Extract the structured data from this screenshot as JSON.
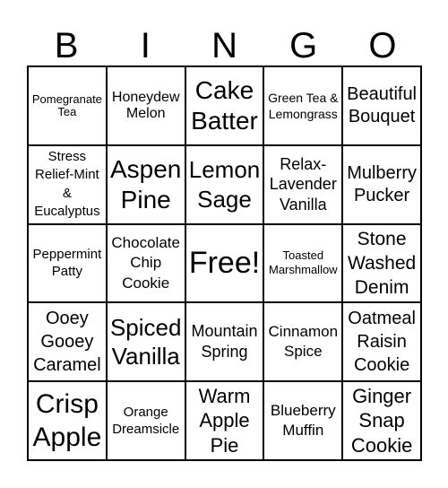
{
  "header": [
    "B",
    "I",
    "N",
    "G",
    "O"
  ],
  "cells": [
    [
      "Pomegranate Tea",
      "Honeydew Melon",
      "Cake Batter",
      "Green Tea & Lemongrass",
      "Beautiful Bouquet"
    ],
    [
      "Stress Relief-Mint & Eucalyptus",
      "Aspen Pine",
      "Lemon Sage",
      "Relax-Lavender Vanilla",
      "Mulberry Pucker"
    ],
    [
      "Peppermint Patty",
      "Chocolate Chip Cookie",
      "Free!",
      "Toasted Marshmallow",
      "Stone Washed Denim"
    ],
    [
      "Ooey Gooey Caramel",
      "Spiced Vanilla",
      "Mountain Spring",
      "Cinnamon Spice",
      "Oatmeal Raisin Cookie"
    ],
    [
      "Crisp Apple",
      "Orange Dreamsicle",
      "Warm Apple Pie",
      "Blueberry Muffin",
      "Ginger Snap Cookie"
    ]
  ]
}
